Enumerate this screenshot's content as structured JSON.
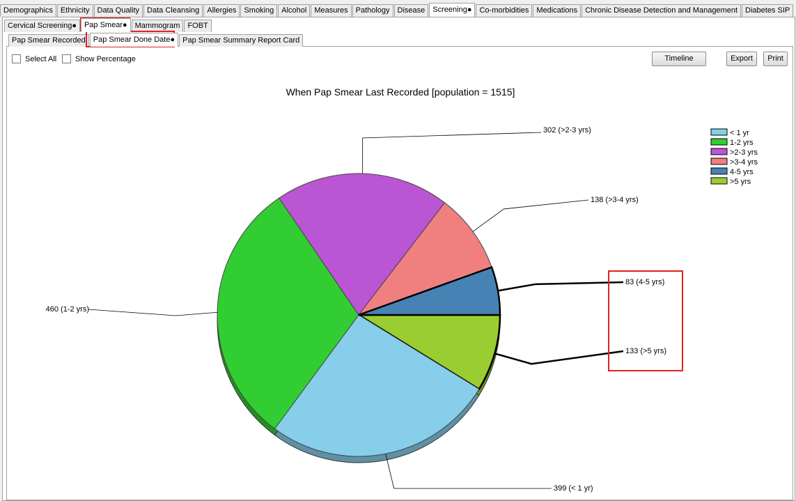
{
  "tabs_main": [
    {
      "label": "Demographics"
    },
    {
      "label": "Ethnicity"
    },
    {
      "label": "Data Quality"
    },
    {
      "label": "Data Cleansing"
    },
    {
      "label": "Allergies"
    },
    {
      "label": "Smoking"
    },
    {
      "label": "Alcohol"
    },
    {
      "label": "Measures"
    },
    {
      "label": "Pathology"
    },
    {
      "label": "Disease"
    },
    {
      "label": "Screening●"
    },
    {
      "label": "Co-morbidities"
    },
    {
      "label": "Medications"
    },
    {
      "label": "Chronic Disease Detection and Management"
    },
    {
      "label": "Diabetes SIP"
    }
  ],
  "tabs_screening": [
    {
      "label": "Cervical Screening●"
    },
    {
      "label": "Pap Smear●"
    },
    {
      "label": "Mammogram"
    },
    {
      "label": "FOBT"
    }
  ],
  "tabs_pap": [
    {
      "label": "Pap Smear Recorded"
    },
    {
      "label": "Pap Smear Done Date●"
    },
    {
      "label": "Pap Smear Summary Report Card"
    }
  ],
  "controls": {
    "select_all": "Select All",
    "show_percentage": "Show Percentage",
    "timeline": "Timeline",
    "export": "Export",
    "print": "Print"
  },
  "chart_data": {
    "type": "pie",
    "title": "When Pap Smear Last Recorded [population = 1515]",
    "legend_position": "top-right",
    "categories": [
      "< 1 yr",
      "1-2 yrs",
      ">2-3 yrs",
      ">3-4 yrs",
      "4-5 yrs",
      ">5 yrs"
    ],
    "values": [
      399,
      460,
      302,
      138,
      83,
      133
    ],
    "labels": [
      "399 (< 1 yr)",
      "460 (1-2 yrs)",
      "302 (>2-3 yrs)",
      "138 (>3-4 yrs)",
      "83 (4-5 yrs)",
      "133 (>5 yrs)"
    ],
    "colors": [
      "#87ceeb",
      "#32cd32",
      "#ba55d3",
      "#f08080",
      "#4682b4",
      "#9acd32"
    ]
  }
}
